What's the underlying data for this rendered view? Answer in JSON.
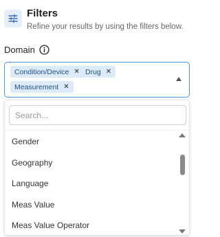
{
  "header": {
    "title": "Filters",
    "subtitle": "Refine your results by using the filters below.",
    "icon": "sliders-icon"
  },
  "field": {
    "label": "Domain",
    "info_icon": "info-icon"
  },
  "selected_chips": [
    {
      "label": "Condition/Device",
      "remove": "✕"
    },
    {
      "label": "Drug",
      "remove": "✕"
    },
    {
      "label": "Measurement",
      "remove": "✕"
    }
  ],
  "dropdown": {
    "search_placeholder": "Search...",
    "options": [
      "Gender",
      "Geography",
      "Language",
      "Meas Value",
      "Meas Value Operator"
    ]
  },
  "colors": {
    "accent": "#4a95e0",
    "chip_bg": "#ddeaf8",
    "chip_text": "#1d4f8c",
    "icon_bg": "#e6eef9"
  }
}
